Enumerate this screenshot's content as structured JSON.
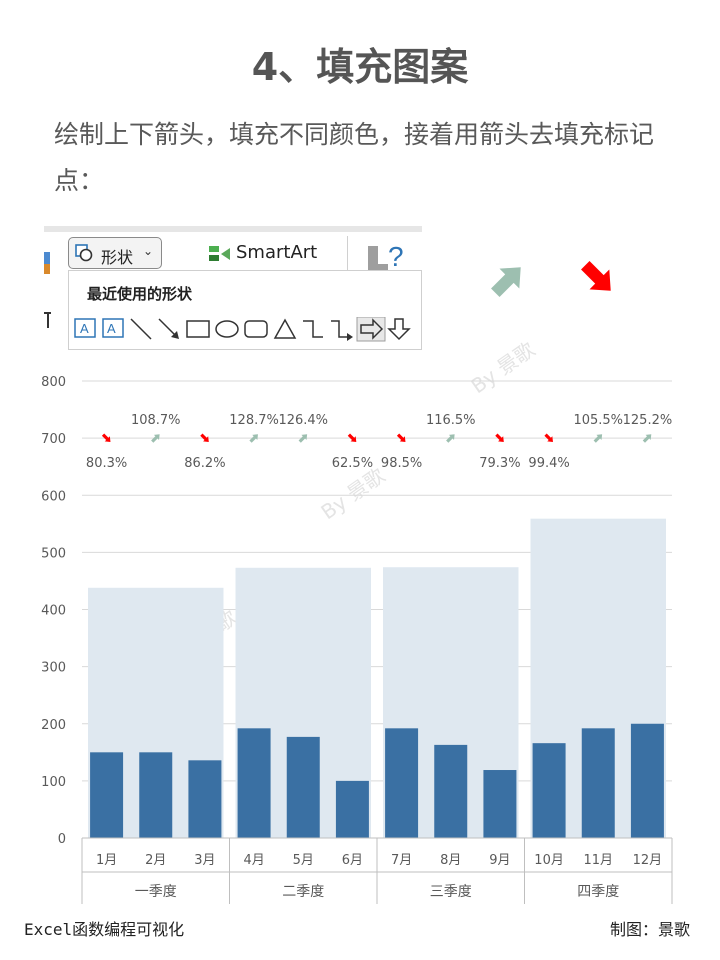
{
  "page": {
    "title": "4、填充图案",
    "intro": "绘制上下箭头，填充不同颜色，接着用箭头去填充标记点：",
    "footer_left": "Excel函数编程可视化",
    "footer_right": "制图：景歌",
    "watermark": "By 景歌"
  },
  "ribbon": {
    "shape_button": "形状",
    "smartart_label": "SmartArt",
    "recent_shapes_header": "最近使用的形状",
    "icons": [
      "shape-icon",
      "smartart-icon",
      "help-icon"
    ]
  },
  "arrow_samples": {
    "up_color": "#9dbfb0",
    "down_color": "#ff0000"
  },
  "chart_data": {
    "type": "bar",
    "ylim": [
      0,
      800
    ],
    "yticks": [
      0,
      100,
      200,
      300,
      400,
      500,
      600,
      700,
      800
    ],
    "categories": [
      "1月",
      "2月",
      "3月",
      "4月",
      "5月",
      "6月",
      "7月",
      "8月",
      "9月",
      "10月",
      "11月",
      "12月"
    ],
    "groups": [
      {
        "label": "一季度",
        "members": [
          0,
          1,
          2
        ]
      },
      {
        "label": "二季度",
        "members": [
          3,
          4,
          5
        ]
      },
      {
        "label": "三季度",
        "members": [
          6,
          7,
          8
        ]
      },
      {
        "label": "四季度",
        "members": [
          9,
          10,
          11
        ]
      }
    ],
    "series": [
      {
        "values": [
          438,
          473,
          474,
          559
        ],
        "color": "#dfe8f0",
        "kind": "quarter-background"
      },
      {
        "values": [
          150,
          150,
          136,
          192,
          177,
          100,
          192,
          163,
          119,
          166,
          192,
          200
        ],
        "color": "#3a70a3",
        "kind": "monthly"
      }
    ],
    "markers": {
      "y": 700,
      "labels": [
        "80.3%",
        "108.7%",
        "86.2%",
        "128.7%",
        "126.4%",
        "62.5%",
        "98.5%",
        "116.5%",
        "79.3%",
        "99.4%",
        "105.5%",
        "125.2%"
      ],
      "direction": [
        "down",
        "up",
        "down",
        "up",
        "up",
        "down",
        "down",
        "up",
        "down",
        "down",
        "up",
        "up"
      ],
      "up_color": "#9dbfb0",
      "down_color": "#ff0000"
    },
    "colors": {
      "grid": "#d9d9d9",
      "axis_text": "#595959",
      "axis_line": "#bfbfbf"
    }
  }
}
